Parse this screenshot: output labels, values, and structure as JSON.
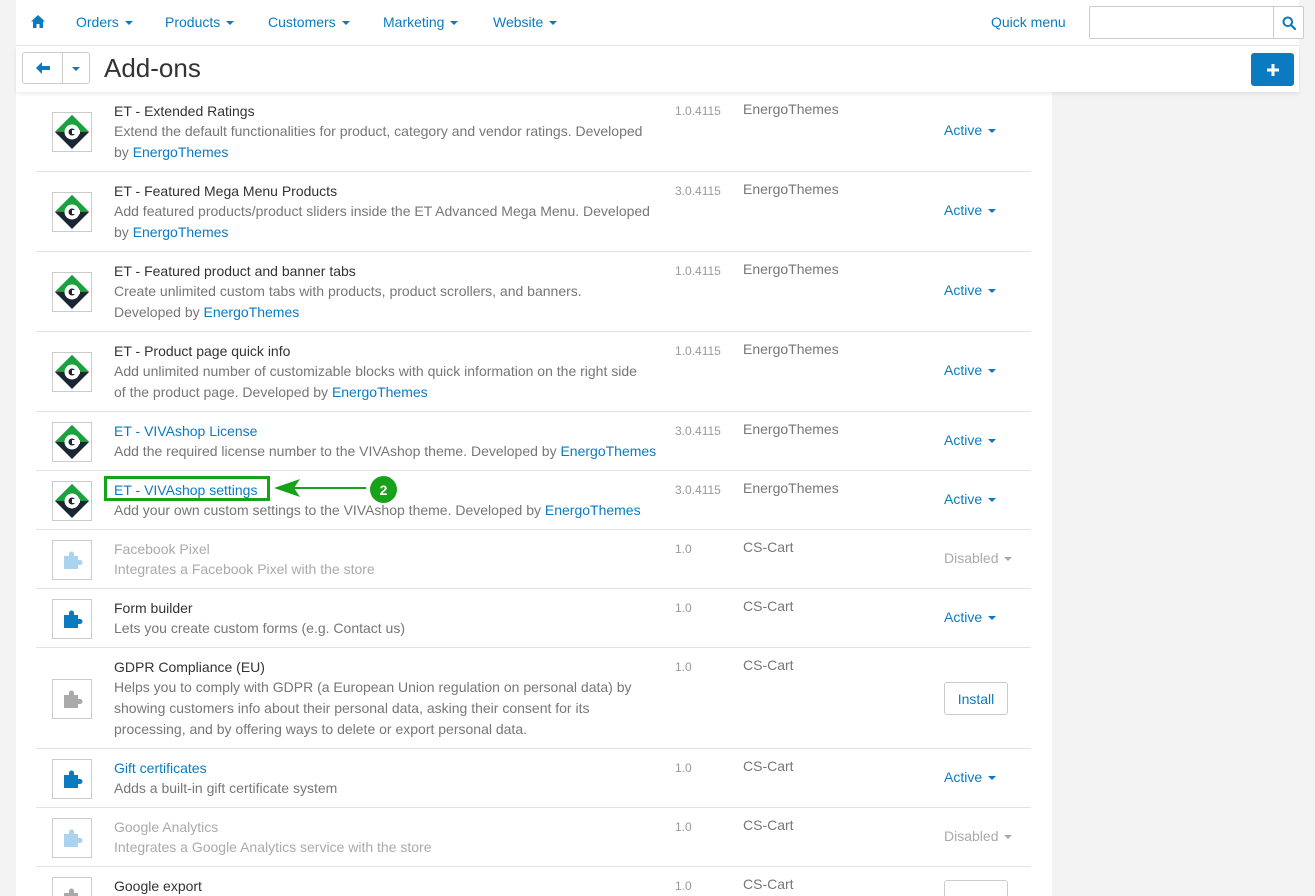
{
  "nav": {
    "items": [
      {
        "label": "Orders"
      },
      {
        "label": "Products"
      },
      {
        "label": "Customers"
      },
      {
        "label": "Marketing"
      },
      {
        "label": "Website"
      }
    ],
    "quick_menu": "Quick menu",
    "search_value": ""
  },
  "page": {
    "title": "Add-ons"
  },
  "colors": {
    "accent": "#0b7bc1",
    "annotation": "#16a21b",
    "disabled": "#aaaaaa"
  },
  "addons": [
    {
      "icon": "energothemes-logo-icon",
      "name": "ET - Extended Ratings",
      "link": false,
      "desc": "Extend the default functionalities for product, category and vendor ratings. Developed",
      "desc2": "by ",
      "dev": "EnergoThemes",
      "version": "1.0.4115",
      "author": "EnergoThemes",
      "status": "Active"
    },
    {
      "icon": "energothemes-logo-icon",
      "name": "ET - Featured Mega Menu Products",
      "link": false,
      "desc": "Add featured products/product sliders inside the ET Advanced Mega Menu. Developed",
      "desc2": "by ",
      "dev": "EnergoThemes",
      "version": "3.0.4115",
      "author": "EnergoThemes",
      "status": "Active"
    },
    {
      "icon": "energothemes-logo-icon",
      "name": "ET - Featured product and banner tabs",
      "link": false,
      "desc": "Create unlimited custom tabs with products, product scrollers, and banners.",
      "desc2": "Developed by ",
      "dev": "EnergoThemes",
      "version": "1.0.4115",
      "author": "EnergoThemes",
      "status": "Active"
    },
    {
      "icon": "energothemes-logo-icon",
      "name": "ET - Product page quick info",
      "link": false,
      "desc": "Add unlimited number of customizable blocks with quick information on the right side",
      "desc2": "of the product page. Developed by ",
      "dev": "EnergoThemes",
      "version": "1.0.4115",
      "author": "EnergoThemes",
      "status": "Active"
    },
    {
      "icon": "energothemes-logo-icon",
      "name": "ET - VIVAshop License",
      "link": true,
      "desc": "Add the required license number to the VIVAshop theme. Developed by ",
      "desc2": "",
      "dev": "EnergoThemes",
      "version": "3.0.4115",
      "author": "EnergoThemes",
      "status": "Active"
    },
    {
      "icon": "energothemes-logo-icon",
      "name": "ET - VIVAshop settings",
      "link": true,
      "desc": "Add your own custom settings to the VIVAshop theme. Developed by ",
      "desc2": "",
      "dev": "EnergoThemes",
      "version": "3.0.4115",
      "author": "EnergoThemes",
      "status": "Active"
    },
    {
      "icon": "puzzle-icon",
      "name": "Facebook Pixel",
      "link": false,
      "desc": "Integrates a Facebook Pixel with the store",
      "desc2": "",
      "dev": "",
      "version": "1.0",
      "author": "CS-Cart",
      "status": "Disabled"
    },
    {
      "icon": "puzzle-icon",
      "name": "Form builder",
      "link": false,
      "desc": "Lets you create custom forms (e.g. Contact us)",
      "desc2": "",
      "dev": "",
      "version": "1.0",
      "author": "CS-Cart",
      "status": "Active"
    },
    {
      "icon": "puzzle-icon",
      "name": "GDPR Compliance (EU)",
      "link": false,
      "desc": "Helps you to comply with GDPR (a European Union regulation on personal data) by",
      "desc2": "showing customers info about their personal data, asking their consent for its",
      "desc3": "processing, and by offering ways to delete or export personal data.",
      "dev": "",
      "version": "1.0",
      "author": "CS-Cart",
      "status": "",
      "install_label": "Install"
    },
    {
      "icon": "puzzle-icon",
      "name": "Gift certificates",
      "link": true,
      "desc": "Adds a built-in gift certificate system",
      "desc2": "",
      "dev": "",
      "version": "1.0",
      "author": "CS-Cart",
      "status": "Active"
    },
    {
      "icon": "puzzle-icon",
      "name": "Google Analytics",
      "link": false,
      "desc": "Integrates a Google Analytics service with the store",
      "desc2": "",
      "dev": "",
      "version": "1.0",
      "author": "CS-Cart",
      "status": "Disabled"
    },
    {
      "icon": "puzzle-icon",
      "name": "Google export",
      "link": false,
      "desc": "",
      "desc2": "",
      "dev": "",
      "version": "1.0",
      "author": "CS-Cart",
      "status": "",
      "install_label": ""
    }
  ],
  "annotation": {
    "step": "2"
  }
}
